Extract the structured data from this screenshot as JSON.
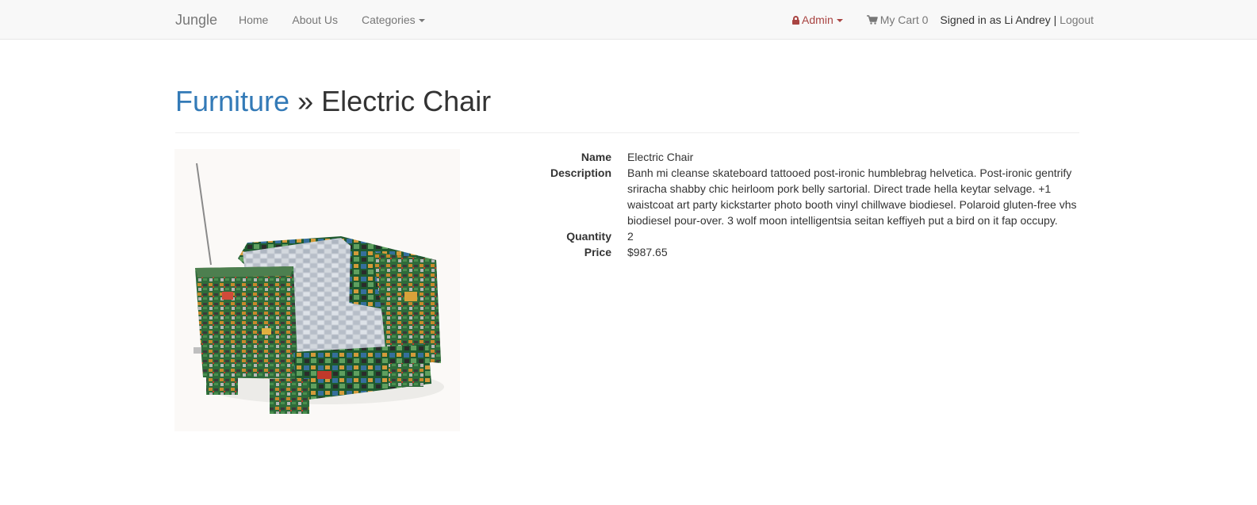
{
  "navbar": {
    "brand": "Jungle",
    "links": {
      "home": "Home",
      "about": "About Us",
      "categories": "Categories"
    },
    "admin": "Admin",
    "cart_label": "My Cart",
    "cart_count": "0",
    "signed_in_prefix": "Signed in as",
    "user_name": "Li Andrey",
    "separator": "|",
    "logout": "Logout",
    "admin_color": "#a94442"
  },
  "breadcrumb": {
    "category": "Furniture",
    "separator": "»",
    "product": "Electric Chair"
  },
  "product": {
    "labels": {
      "name": "Name",
      "description": "Description",
      "quantity": "Quantity",
      "price": "Price"
    },
    "name": "Electric Chair",
    "description": "Banh mi cleanse skateboard tattooed post-ironic humblebrag helvetica. Post-ironic gentrify sriracha shabby chic heirloom pork belly sartorial. Direct trade hella keytar selvage. +1 waistcoat art party kickstarter photo booth vinyl chillwave biodiesel. Polaroid gluten-free vhs biodiesel pour-over. 3 wolf moon intelligentsia seitan keffiyeh put a bird on it fap occupy.",
    "quantity": "2",
    "price": "$987.65",
    "image_subject": "armchair-made-of-circuit-boards"
  },
  "colors": {
    "link": "#337ab7",
    "navbar_bg": "#f8f8f8",
    "muted": "#777777"
  }
}
